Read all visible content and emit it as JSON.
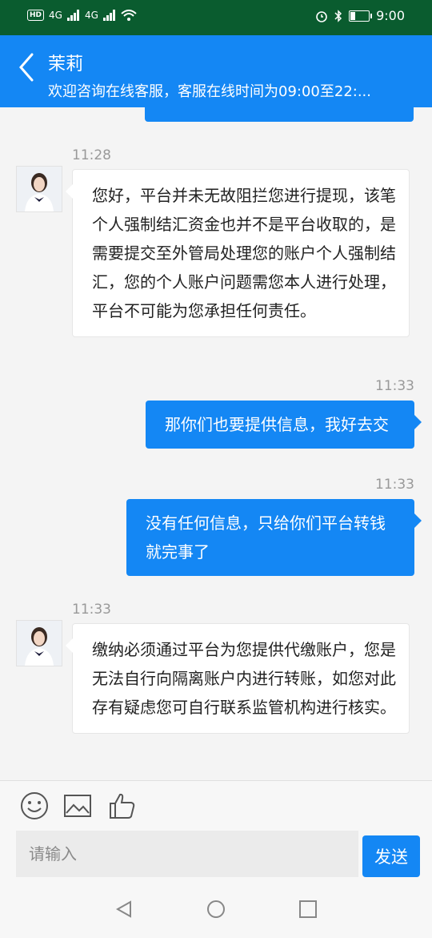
{
  "status": {
    "net1": "4G",
    "net2": "4G",
    "hd": "HD",
    "time": "9:00"
  },
  "header": {
    "title": "茉莉",
    "subtitle": "欢迎咨询在线客服，客服在线时间为09:00至22:..."
  },
  "messages": [
    {
      "side": "in",
      "time": "11:28",
      "text": "您好，平台并未无故阻拦您进行提现，该笔个人强制结汇资金也并不是平台收取的，是需要提交至外管局处理您的账户个人强制结汇，您的个人账户问题需您本人进行处理，平台不可能为您承担任何责任。"
    },
    {
      "side": "out",
      "time": "11:33",
      "text": "那你们也要提供信息，我好去交"
    },
    {
      "side": "out",
      "time": "11:33",
      "text": "没有任何信息，只给你们平台转钱就完事了"
    },
    {
      "side": "in",
      "time": "11:33",
      "text": "缴纳必须通过平台为您提供代缴账户，您是无法自行向隔离账户内进行转账，如您对此存有疑虑您可自行联系监管机构进行核实。"
    }
  ],
  "composer": {
    "placeholder": "请输入",
    "send_label": "发送"
  },
  "icons": {
    "emoji": "emoji-icon",
    "image": "image-icon",
    "like": "thumbs-up-icon"
  },
  "colors": {
    "accent": "#1487f4",
    "statusbar": "#0a5c2f"
  }
}
